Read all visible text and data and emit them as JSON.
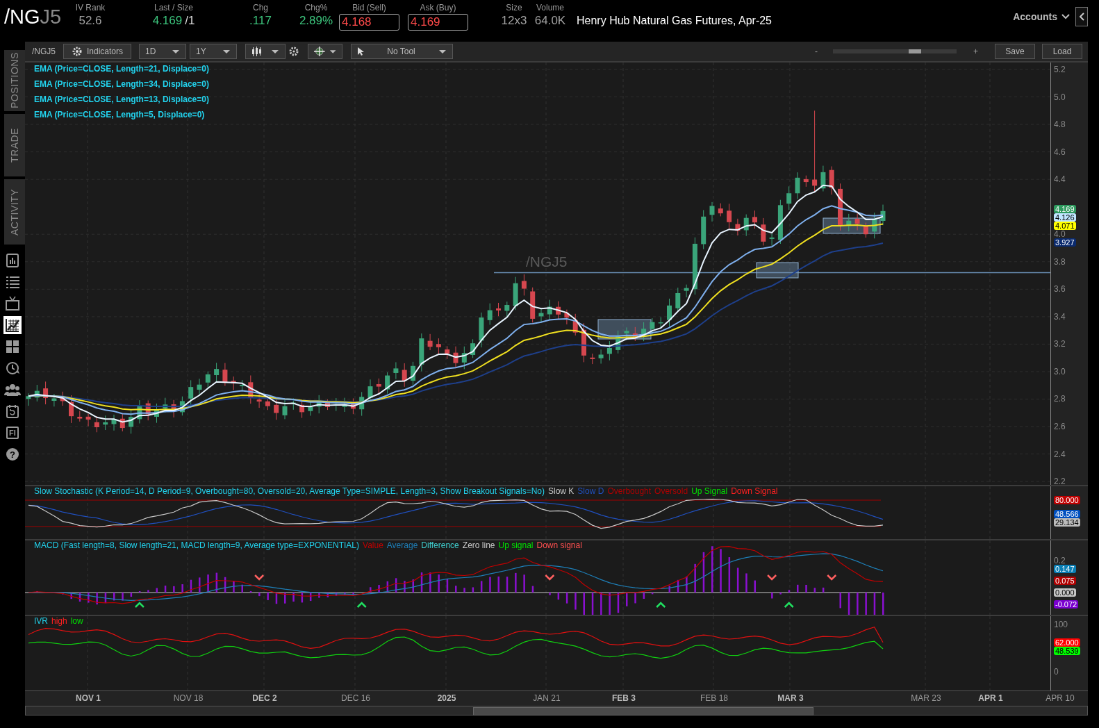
{
  "header": {
    "symbol_root": "/NG",
    "symbol_suffix": "J5",
    "fields": [
      {
        "label": "IV Rank",
        "value": "52.6",
        "color": "#a0a0a0",
        "kind": "plain"
      },
      {
        "label": "Last / Size",
        "value": "4.169",
        "size": "/1",
        "color": "#3cc47c",
        "kind": "plain"
      },
      {
        "label": "Chg",
        "value": ".117",
        "color": "#3cc47c",
        "kind": "plain"
      },
      {
        "label": "Chg%",
        "value": "2.89%",
        "color": "#3cc47c",
        "kind": "plain"
      },
      {
        "label": "Bid (Sell)",
        "value": "4.168",
        "color": "#ff4a4a",
        "kind": "box"
      },
      {
        "label": "Ask (Buy)",
        "value": "4.169",
        "color": "#ff4a4a",
        "kind": "box"
      },
      {
        "label": "Size",
        "value": "12x3",
        "color": "#a0a0a0",
        "kind": "plain"
      },
      {
        "label": "Volume",
        "value": "64.0K",
        "color": "#a0a0a0",
        "kind": "plain"
      }
    ],
    "description": "Henry Hub Natural Gas Futures, Apr-25",
    "accounts": "Accounts"
  },
  "sidebar": {
    "tabs": [
      "POSITIONS",
      "TRADE",
      "ACTIVITY"
    ],
    "icons": [
      {
        "selected": false
      },
      {
        "selected": false
      },
      {
        "selected": false
      },
      {
        "selected": true
      },
      {
        "selected": false
      },
      {
        "selected": false
      },
      {
        "selected": false
      },
      {
        "selected": false
      },
      {
        "label": "FI",
        "selected": false
      },
      {
        "label": "?",
        "selected": false
      }
    ]
  },
  "toolbar": {
    "symbol": "/NGJ5",
    "indicators": "Indicators",
    "aggregation": "1D",
    "period": "1Y",
    "tool": "No Tool",
    "zoom_out": "-",
    "zoom": {
      "level": 0.68
    },
    "zoom_in": "+",
    "save": "Save",
    "load": "Load"
  },
  "price_pane": {
    "legend": [
      "EMA (Price=CLOSE, Length=21, Displace=0)",
      "EMA (Price=CLOSE, Length=34, Displace=0)",
      "EMA (Price=CLOSE, Length=13, Displace=0)",
      "EMA (Price=CLOSE, Length=5, Displace=0)"
    ],
    "line_label": "/NGJ5",
    "ticks": [
      "5.2",
      "5.0",
      "4.8",
      "4.6",
      "4.4",
      "4.0",
      "3.8",
      "3.6",
      "3.4",
      "3.2",
      "3.0",
      "2.8",
      "2.6",
      "2.4",
      "2.2"
    ],
    "badges": [
      {
        "text": "4.169",
        "color": "#2e9a5e"
      },
      {
        "text": "4.126",
        "color": "#bfe6ff"
      },
      {
        "text": "4.071",
        "color": "#ffff00"
      },
      {
        "text": "3.927",
        "color": "#0a2a6e"
      }
    ]
  },
  "stochastic_pane": {
    "title": "Slow Stochastic (K Period=14, D Period=9, Overbought=80, Oversold=20, Average Type=SIMPLE, Length=3, Show Breakout Signals=No)",
    "legend": [
      {
        "text": "Slow K",
        "color": "#c8c8c8"
      },
      {
        "text": "Slow D",
        "color": "#2050c0"
      },
      {
        "text": "Overbought",
        "color": "#b00000"
      },
      {
        "text": "Oversold",
        "color": "#b00000"
      },
      {
        "text": "Up Signal",
        "color": "#00e000"
      },
      {
        "text": "Down Signal",
        "color": "#ff2020"
      }
    ],
    "badges": [
      {
        "text": "80.000",
        "color": "#c00000"
      },
      {
        "text": "48.566",
        "color": "#0050c0"
      },
      {
        "text": "29.134",
        "color": "#bbbbbb"
      }
    ]
  },
  "macd_pane": {
    "title": "MACD (Fast length=8, Slow length=21, MACD length=9, Average type=EXPONENTIAL)",
    "legend": [
      {
        "text": "Value",
        "color": "#c00000"
      },
      {
        "text": "Average",
        "color": "#1e7fb8"
      },
      {
        "text": "Difference",
        "color": "#40d0d0"
      },
      {
        "text": "Zero line",
        "color": "#c8c8c8"
      },
      {
        "text": "Up signal",
        "color": "#00e000"
      },
      {
        "text": "Down signal",
        "color": "#ff5050"
      }
    ],
    "ticks": [
      "0.2"
    ],
    "badges": [
      {
        "text": "0.147",
        "color": "#0a7fb5"
      },
      {
        "text": "0.075",
        "color": "#b00000"
      },
      {
        "text": "0.000",
        "color": "#c8c8c8"
      },
      {
        "text": "-0.072",
        "color": "#7a00d0"
      }
    ]
  },
  "ivr_pane": {
    "legend": [
      {
        "text": "IVR",
        "color": "#22d3ee"
      },
      {
        "text": "high",
        "color": "#ff2020"
      },
      {
        "text": "low",
        "color": "#00e000"
      }
    ],
    "ticks": [
      "100",
      "0"
    ],
    "badges": [
      {
        "text": "62.000",
        "color": "#ff0000"
      },
      {
        "text": "48.539",
        "color": "#00ff00"
      }
    ]
  },
  "date_axis": [
    {
      "text": "NOV 1",
      "bold": true
    },
    {
      "text": "NOV 18",
      "bold": false
    },
    {
      "text": "DEC 2",
      "bold": true
    },
    {
      "text": "DEC 16",
      "bold": false
    },
    {
      "text": "2025",
      "bold": true
    },
    {
      "text": "JAN 21",
      "bold": false
    },
    {
      "text": "FEB 3",
      "bold": true
    },
    {
      "text": "FEB 18",
      "bold": false
    },
    {
      "text": "MAR 3",
      "bold": true
    },
    {
      "text": "MAR 23",
      "bold": false
    },
    {
      "text": "APR 1",
      "bold": true
    },
    {
      "text": "APR 10",
      "bold": false
    }
  ]
}
